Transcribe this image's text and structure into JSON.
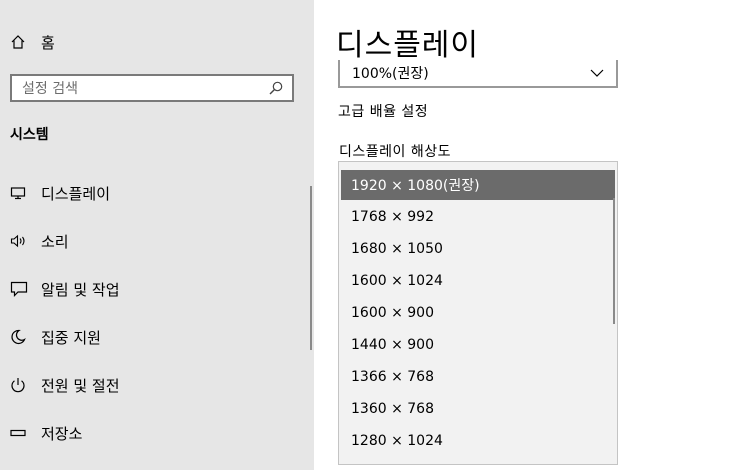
{
  "sidebar": {
    "home_label": "홈",
    "search_placeholder": "설정 검색",
    "section_title": "시스템",
    "items": [
      {
        "label": "디스플레이",
        "icon": "monitor-icon"
      },
      {
        "label": "소리",
        "icon": "speaker-icon"
      },
      {
        "label": "알림 및 작업",
        "icon": "notification-icon"
      },
      {
        "label": "집중 지원",
        "icon": "moon-icon"
      },
      {
        "label": "전원 및 절전",
        "icon": "power-icon"
      },
      {
        "label": "저장소",
        "icon": "storage-icon"
      }
    ]
  },
  "main": {
    "page_title": "디스플레이",
    "scale_value": "100%(권장)",
    "advanced_scaling_link": "고급 배율 설정",
    "resolution_label": "디스플레이 해상도",
    "resolution_options": [
      "1920 × 1080(권장)",
      "1768 × 992",
      "1680 × 1050",
      "1600 × 1024",
      "1600 × 900",
      "1440 × 900",
      "1366 × 768",
      "1360 × 768",
      "1280 × 1024"
    ],
    "selected_index": 0
  },
  "colors": {
    "sidebar_bg": "#e6e6e6",
    "selected_bg": "#6b6b6b",
    "dropdown_bg": "#f2f2f2"
  }
}
